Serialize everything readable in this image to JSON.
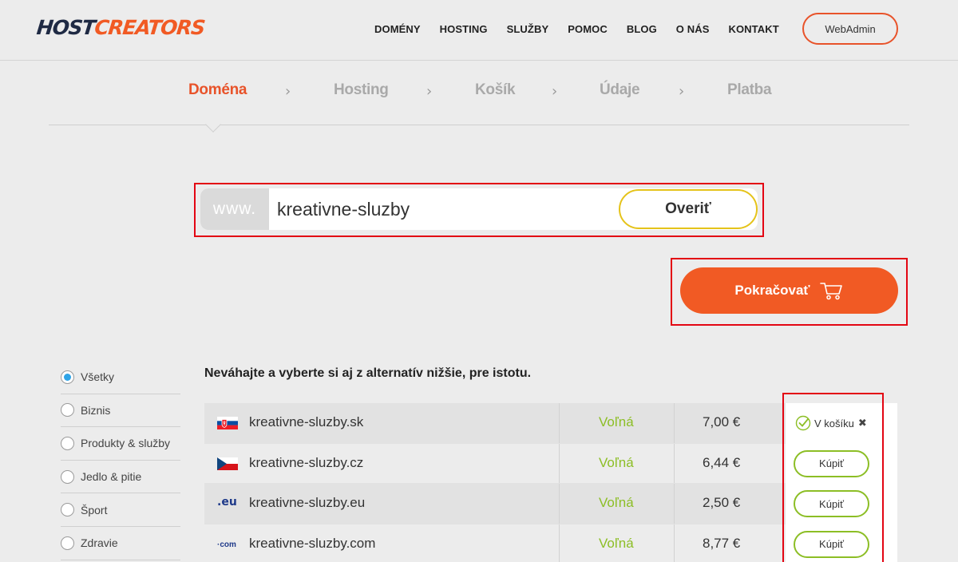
{
  "header": {
    "logo_host": "HOST",
    "logo_creators": "CREATORS",
    "nav": [
      "DOMÉNY",
      "HOSTING",
      "SLUŽBY",
      "POMOC",
      "BLOG",
      "O NÁS",
      "KONTAKT"
    ],
    "webadmin_label": "WebAdmin"
  },
  "steps": [
    "Doména",
    "Hosting",
    "Košík",
    "Údaje",
    "Platba"
  ],
  "search": {
    "prefix": "www.",
    "value": "kreativne-sluzby",
    "verify_label": "Overiť"
  },
  "continue_label": "Pokračovať",
  "filters": [
    {
      "label": "Všetky",
      "checked": true
    },
    {
      "label": "Biznis",
      "checked": false
    },
    {
      "label": "Produkty & služby",
      "checked": false
    },
    {
      "label": "Jedlo & pitie",
      "checked": false
    },
    {
      "label": "Šport",
      "checked": false
    },
    {
      "label": "Zdravie",
      "checked": false
    }
  ],
  "results": {
    "title": "Neváhajte a vyberte si aj z alternatív nižšie, pre istotu.",
    "rows": [
      {
        "domain": "kreativne-sluzby.sk",
        "status": "Voľná",
        "price": "7,00 €",
        "flag": "sk",
        "in_cart": true,
        "action_label": "V košíku"
      },
      {
        "domain": "kreativne-sluzby.cz",
        "status": "Voľná",
        "price": "6,44 €",
        "flag": "cz",
        "in_cart": false,
        "action_label": "Kúpiť"
      },
      {
        "domain": "kreativne-sluzby.eu",
        "status": "Voľná",
        "price": "2,50 €",
        "flag": "eu",
        "in_cart": false,
        "action_label": "Kúpiť"
      },
      {
        "domain": "kreativne-sluzby.com",
        "status": "Voľná",
        "price": "8,77 €",
        "flag": "com",
        "in_cart": false,
        "action_label": "Kúpiť"
      }
    ]
  },
  "colors": {
    "accent": "#f15a24",
    "available": "#8cbe25",
    "highlight": "#e30613",
    "verify_border": "#e5c31a"
  },
  "icons": {
    "cart": "shopping-cart-icon",
    "check": "check-circle-icon",
    "remove": "close-icon",
    "chevron": "chevron-right-icon"
  },
  "logos": {
    "eu": ".eu",
    "com": "·com"
  }
}
